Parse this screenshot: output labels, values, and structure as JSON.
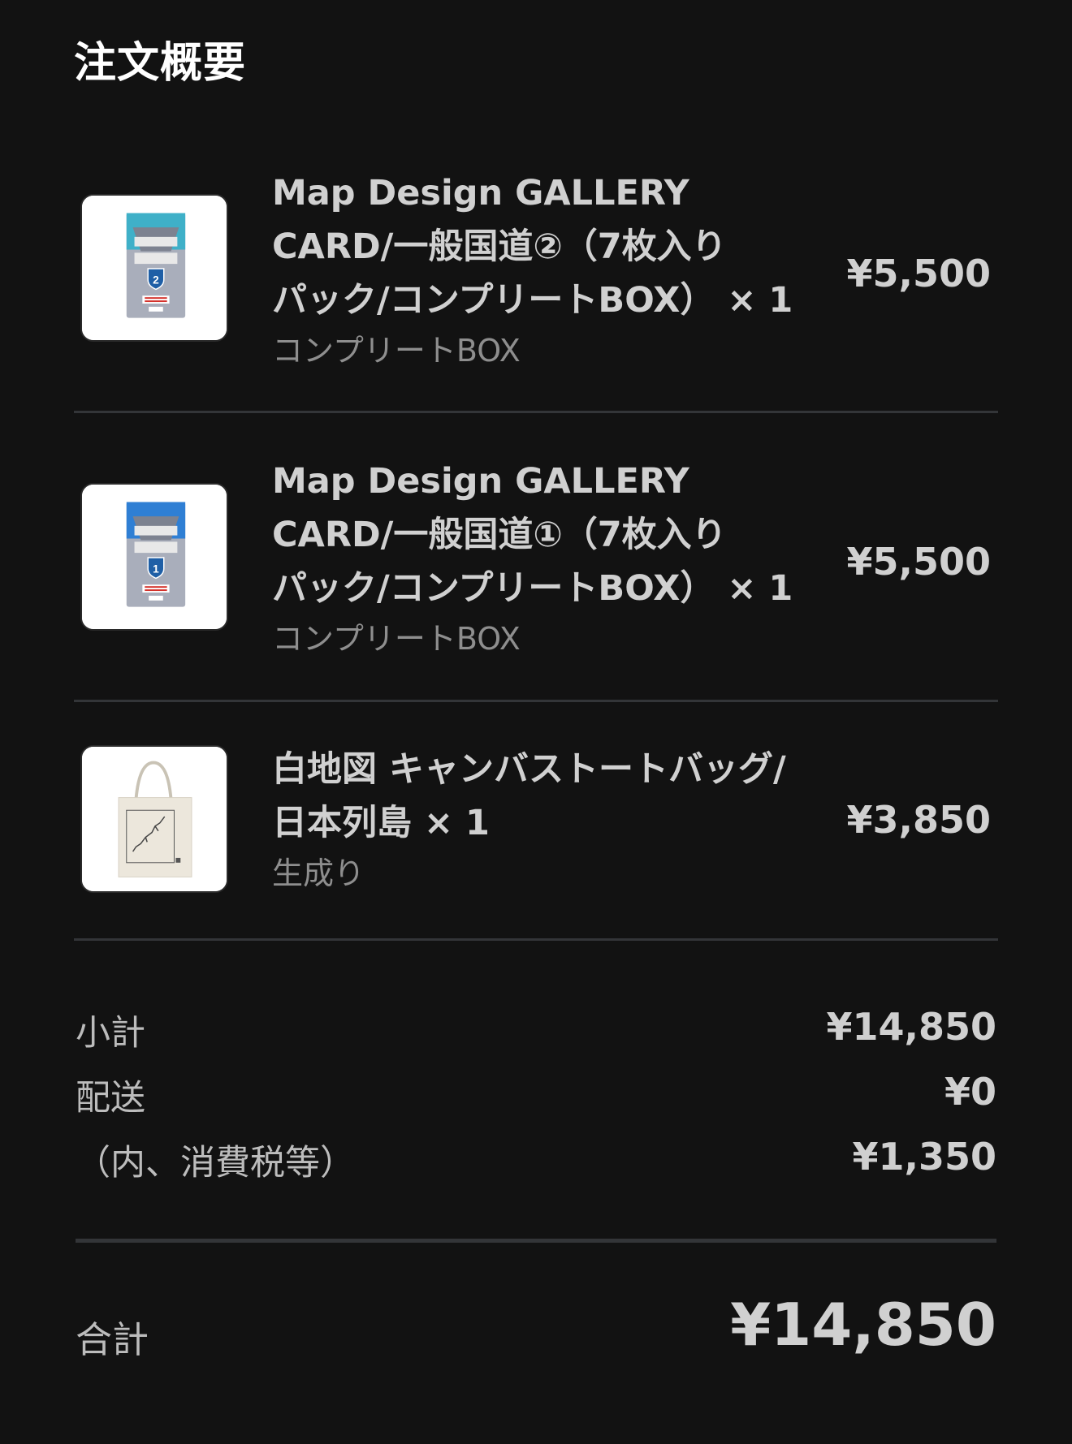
{
  "header": {
    "title": "注文概要"
  },
  "items": [
    {
      "name": "Map Design GALLERY\nCARD/一般国道②（7枚入り\nパック/コンプリートBOX） × 1",
      "variant": "コンプリートBOX",
      "price": "¥5,500",
      "image_icon": "card-box-2-thumbnail",
      "badge_number": "2"
    },
    {
      "name": "Map Design GALLERY\nCARD/一般国道①（7枚入り\nパック/コンプリートBOX） × 1",
      "variant": "コンプリートBOX",
      "price": "¥5,500",
      "image_icon": "card-box-1-thumbnail",
      "badge_number": "1"
    },
    {
      "name": "白地図 キャンバストートバッグ/\n日本列島 × 1",
      "variant": "生成り",
      "price": "¥3,850",
      "image_icon": "tote-bag-thumbnail"
    }
  ],
  "summary": {
    "subtotal_label": "小計",
    "subtotal_value": "¥14,850",
    "shipping_label": "配送",
    "shipping_value": "¥0",
    "tax_label": "（内、消費税等）",
    "tax_value": "¥1,350"
  },
  "total": {
    "label": "合計",
    "value": "¥14,850"
  },
  "colors": {
    "background": "#121212",
    "text_primary": "#d0d0d0",
    "text_secondary": "#8e8e8e",
    "divider": "#333538"
  }
}
